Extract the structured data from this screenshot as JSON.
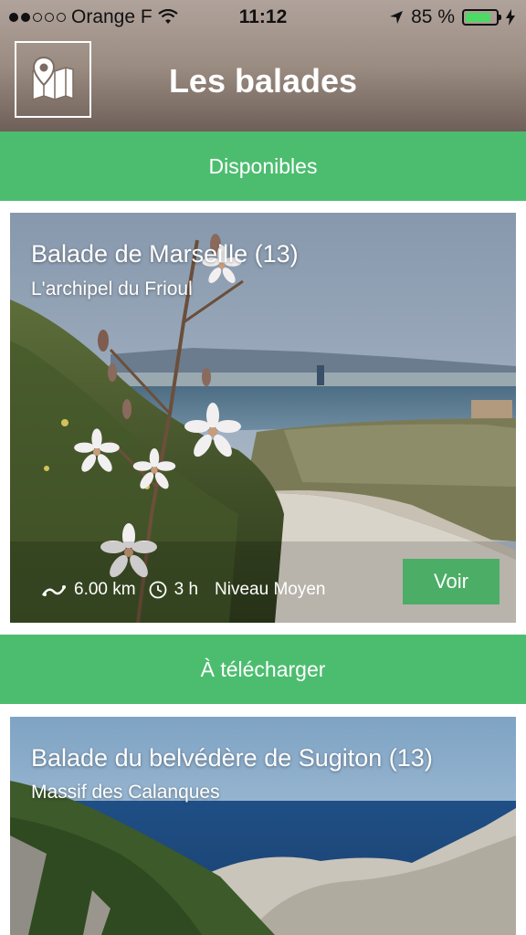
{
  "status_bar": {
    "carrier": "Orange F",
    "time": "11:12",
    "battery": "85 %",
    "signal_bars": 2,
    "signal_total": 5,
    "battery_level": 0.85
  },
  "header": {
    "title": "Les balades",
    "map_icon": "map-pin-icon"
  },
  "sections": {
    "available": "Disponibles",
    "download": "À télécharger"
  },
  "walks": [
    {
      "title": "Balade de Marseille (13)",
      "subtitle": "L'archipel du Frioul",
      "distance": "6.00 km",
      "duration": "3 h",
      "level": "Niveau Moyen",
      "action": "Voir"
    },
    {
      "title": "Balade du belvédère de Sugiton (13)",
      "subtitle": "Massif des Calanques"
    }
  ],
  "colors": {
    "accent": "#4cbd6f",
    "button": "#4cad67",
    "header": "#9b8c82"
  }
}
